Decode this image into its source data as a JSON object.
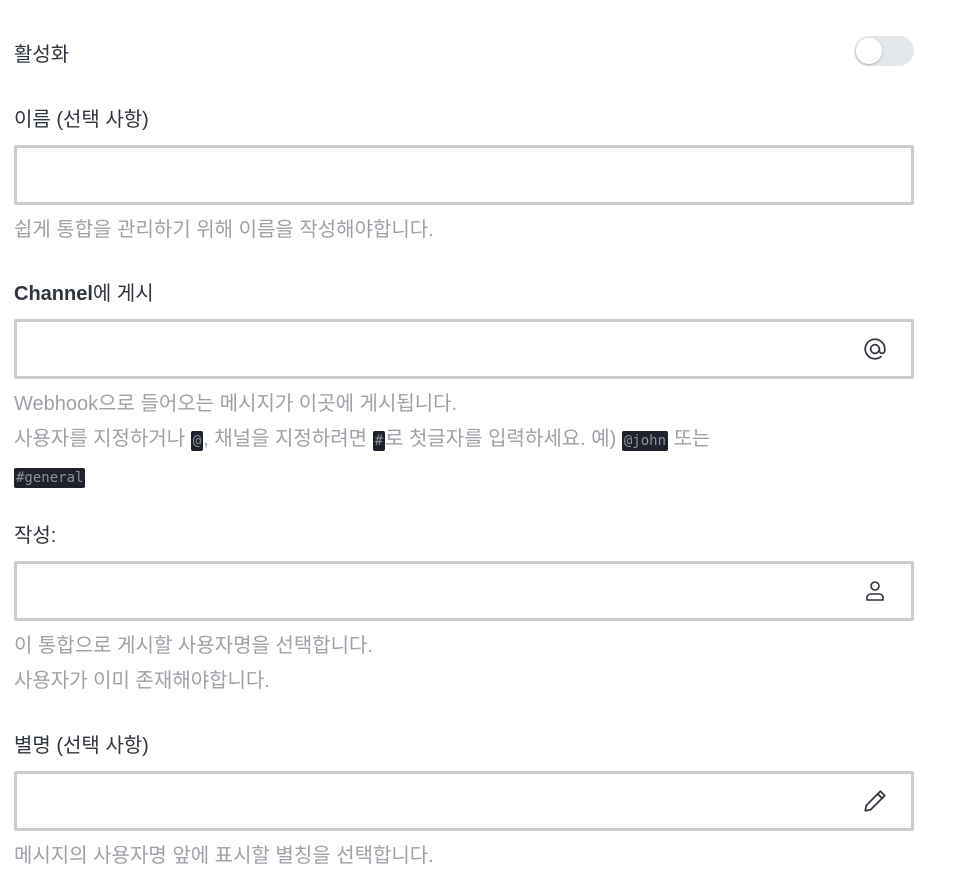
{
  "toggle": {
    "label": "활성화",
    "enabled": false
  },
  "name_field": {
    "label": "이름 (선택 사항)",
    "value": "",
    "placeholder": "",
    "hint": "쉽게 통합을 관리하기 위해 이름을 작성해야합니다."
  },
  "channel_field": {
    "label_strong": "Channel",
    "label_rest": "에 게시",
    "value": "",
    "placeholder": "",
    "icon": "at-icon",
    "hint_line1": "Webhook으로 들어오는 메시지가 이곳에 게시됩니다.",
    "hint_part1": "사용자를 지정하거나 ",
    "hint_code_at": "@",
    "hint_part2": ", 채널을 지정하려면 ",
    "hint_code_hash": "#",
    "hint_part3": "로 첫글자를 입력하세요. 예) ",
    "hint_code_john": "@john",
    "hint_part4": " 또는 ",
    "hint_code_general": "#general"
  },
  "author_field": {
    "label": "작성:",
    "value": "",
    "placeholder": "",
    "icon": "user-icon",
    "hint_line1": "이 통합으로 게시할 사용자명을 선택합니다.",
    "hint_line2": "사용자가 이미 존재해야합니다."
  },
  "alias_field": {
    "label": "별명 (선택 사항)",
    "value": "",
    "placeholder": "",
    "icon": "pencil-icon",
    "hint": "메시지의 사용자명 앞에 표시할 별칭을 선택합니다."
  },
  "colors": {
    "text": "#2f343d",
    "hint": "#9ea2a8",
    "border": "#cbced1",
    "toggle_off": "#e4e7ea",
    "code_bg": "#1f2329"
  }
}
